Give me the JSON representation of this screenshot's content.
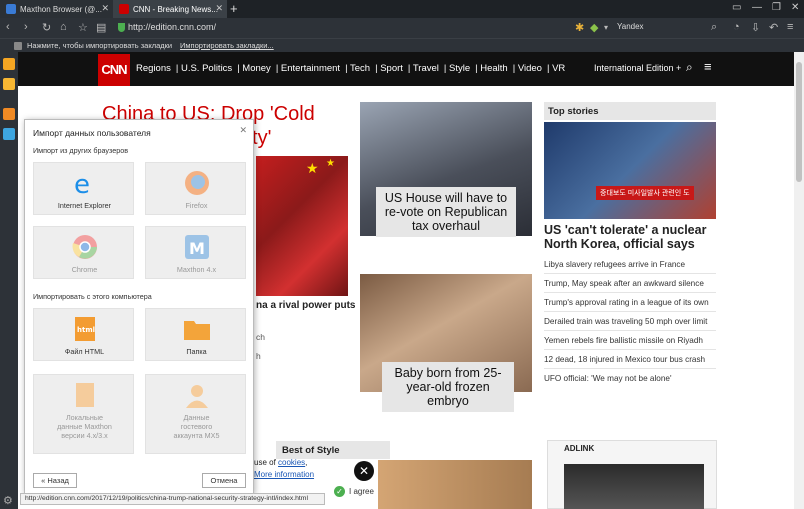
{
  "browser": {
    "tabs": [
      {
        "label": "Maxthon Browser (@..."
      },
      {
        "label": "CNN - Breaking News..."
      }
    ],
    "url": "http://edition.cnn.com/",
    "search_engine": "Yandex",
    "bookmark_bar": {
      "text": "Нажмите, чтобы импортировать закладки",
      "link": "Импортировать закладки..."
    },
    "status_url": "http://edition.cnn.com/2017/12/19/politics/china-trump-national-security-strategy-intl/index.html",
    "colors": {
      "chrome": "#2d3238",
      "titlebar": "#1e2226"
    }
  },
  "cnn": {
    "logo": "CNN",
    "nav": [
      "Regions",
      "U.S. Politics",
      "Money",
      "Entertainment",
      "Tech",
      "Sport",
      "Travel",
      "Style",
      "Health",
      "Video",
      "VR"
    ],
    "edition": "International Edition +",
    "headline": "China to US: Drop 'Cold War mentality'",
    "headline_visible": "China to US: Drop 'Cold",
    "headline_line2": "ality'",
    "left_caption": "na a rival power puts",
    "left_links": [
      "ch",
      "h"
    ],
    "story2_caption": "US House will have to re-vote on Republican tax overhaul",
    "story3_caption": "Baby born from 25-year-old frozen embryo",
    "top_stories": {
      "title": "Top stories",
      "image_overlay": "중대보도 미사일발사 관련인 도",
      "headline": "US 'can't tolerate' a nuclear North Korea, official says",
      "items": [
        "Libya slavery refugees arrive in France",
        "Trump, May speak after an awkward silence",
        "Trump's approval rating in a league of its own",
        "Derailed train was traveling 50 mph over limit",
        "Yemen rebels fire ballistic missile on Riyadh",
        "12 dead, 18 injured in Mexico tour bus crash",
        "UFO official: 'We may not be alone'"
      ]
    },
    "best_of_style": "Best of Style",
    "ad_logo": "ADLINK",
    "cookie": {
      "text1": "use of",
      "link": "cookies",
      "text2": "More information",
      "agree": "I agree"
    },
    "colors": {
      "brand": "#cc0000"
    }
  },
  "import_dialog": {
    "title": "Импорт данных пользователя",
    "section1": "Импорт из других браузеров",
    "section2": "Импортировать с этого компьютера",
    "tiles": [
      {
        "label": "Internet Explorer",
        "icon": "internet-explorer-icon",
        "dim": false
      },
      {
        "label": "Firefox",
        "icon": "firefox-icon",
        "dim": true
      },
      {
        "label": "Chrome",
        "icon": "chrome-icon",
        "dim": true
      },
      {
        "label": "Maxthon 4.x",
        "icon": "maxthon-icon",
        "dim": true
      },
      {
        "label": "Файл HTML",
        "icon": "html-file-icon",
        "dim": false
      },
      {
        "label": "Папка",
        "icon": "folder-icon",
        "dim": false
      },
      {
        "label": "Локальные данные Maxthon версии 4.x/3.x",
        "icon": "local-data-icon",
        "dim": true
      },
      {
        "label": "Данные гостевого аккаунта MX5",
        "icon": "guest-account-icon",
        "dim": true
      }
    ],
    "back_button": "« Назад",
    "cancel_button": "Отмена"
  }
}
